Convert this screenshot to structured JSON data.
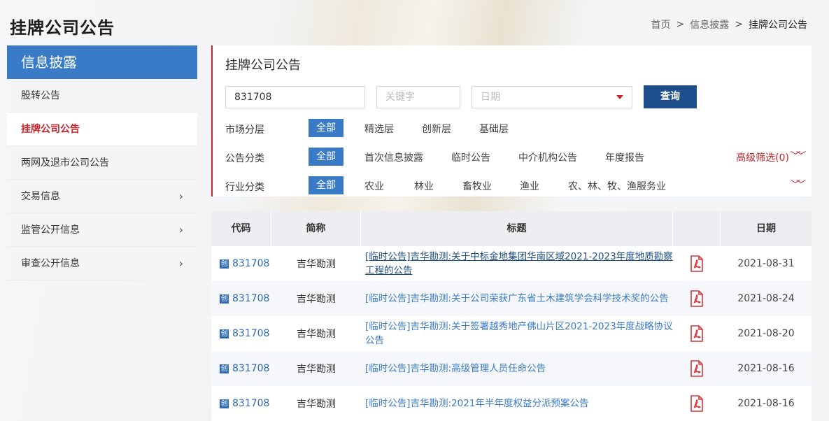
{
  "header": {
    "page_title": "挂牌公司公告",
    "breadcrumb": [
      "首页",
      "信息披露",
      "挂牌公司公告"
    ],
    "breadcrumb_sep": ">"
  },
  "sidebar": {
    "title": "信息披露",
    "items": [
      {
        "label": "股转公告"
      },
      {
        "label": "挂牌公司公告"
      },
      {
        "label": "两网及退市公司公告"
      },
      {
        "label": "交易信息",
        "chevron": "›"
      },
      {
        "label": "监管公开信息",
        "chevron": "›"
      },
      {
        "label": "审查公开信息",
        "chevron": "›"
      }
    ]
  },
  "main": {
    "title": "挂牌公司公告",
    "search": {
      "code_value": "831708",
      "keyword_placeholder": "关键字",
      "date_placeholder": "日期",
      "query_label": "查询"
    },
    "filters": [
      {
        "label": "市场分层",
        "options": [
          "全部",
          "精选层",
          "创新层",
          "基础层"
        ]
      },
      {
        "label": "公告分类",
        "options": [
          "全部",
          "首次信息披露",
          "临时公告",
          "中介机构公告",
          "年度报告"
        ],
        "extra": "高级筛选(0)"
      },
      {
        "label": "行业分类",
        "options": [
          "全部",
          "农业",
          "林业",
          "畜牧业",
          "渔业",
          "农、林、牧、渔服务业"
        ]
      }
    ]
  },
  "table": {
    "headers": [
      "代码",
      "简称",
      "标题",
      "",
      "日期"
    ],
    "badge": "创",
    "rows": [
      {
        "code": "831708",
        "name": "吉华勘测",
        "title": "[临时公告]吉华勘测:关于中标金地集团华南区域2021-2023年度地质勘察工程的公告",
        "date": "2021-08-31"
      },
      {
        "code": "831708",
        "name": "吉华勘测",
        "title": "[临时公告]吉华勘测:关于公司荣获广东省土木建筑学会科学技术奖的公告",
        "date": "2021-08-24"
      },
      {
        "code": "831708",
        "name": "吉华勘测",
        "title": "[临时公告]吉华勘测:关于签署越秀地产佛山片区2021-2023年度战略协议公告",
        "date": "2021-08-20"
      },
      {
        "code": "831708",
        "name": "吉华勘测",
        "title": "[临时公告]吉华勘测:高级管理人员任命公告",
        "date": "2021-08-16"
      },
      {
        "code": "831708",
        "name": "吉华勘测",
        "title": "[临时公告]吉华勘测:2021年半年度权益分派预案公告",
        "date": "2021-08-16"
      }
    ]
  },
  "colors": {
    "accent": "#3a7bc8",
    "brand_red": "#c4262c",
    "button": "#1f4e8c"
  },
  "icons": {
    "pdf": "pdf-icon",
    "chevron": "chevron-right-icon",
    "dropdown": "caret-down-icon"
  }
}
